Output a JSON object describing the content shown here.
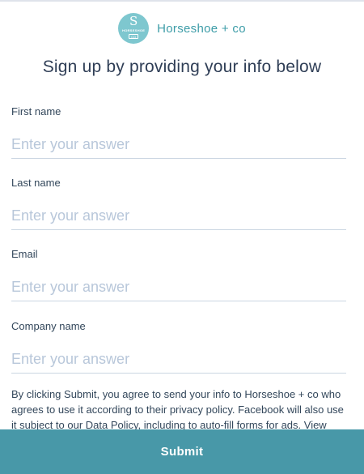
{
  "brand": {
    "name": "Horseshoe + co",
    "logo_letter": "S",
    "logo_word": "HORSESHOE",
    "logo_tag": "CO",
    "color": "#7ec7cf"
  },
  "form": {
    "title": "Sign up by providing your info below",
    "fields": [
      {
        "label": "First name",
        "placeholder": "Enter your answer",
        "value": ""
      },
      {
        "label": "Last name",
        "placeholder": "Enter your answer",
        "value": ""
      },
      {
        "label": "Email",
        "placeholder": "Enter your answer",
        "value": ""
      },
      {
        "label": "Company name",
        "placeholder": "Enter your answer",
        "value": ""
      }
    ],
    "disclaimer": "By clicking Submit, you agree to send your info to Horseshoe + co who agrees to use it according to their privacy policy. Facebook will also use it subject to our Data Policy, including to auto-fill forms for ads. View"
  },
  "submit": {
    "label": "Submit",
    "color": "#4898a8"
  }
}
